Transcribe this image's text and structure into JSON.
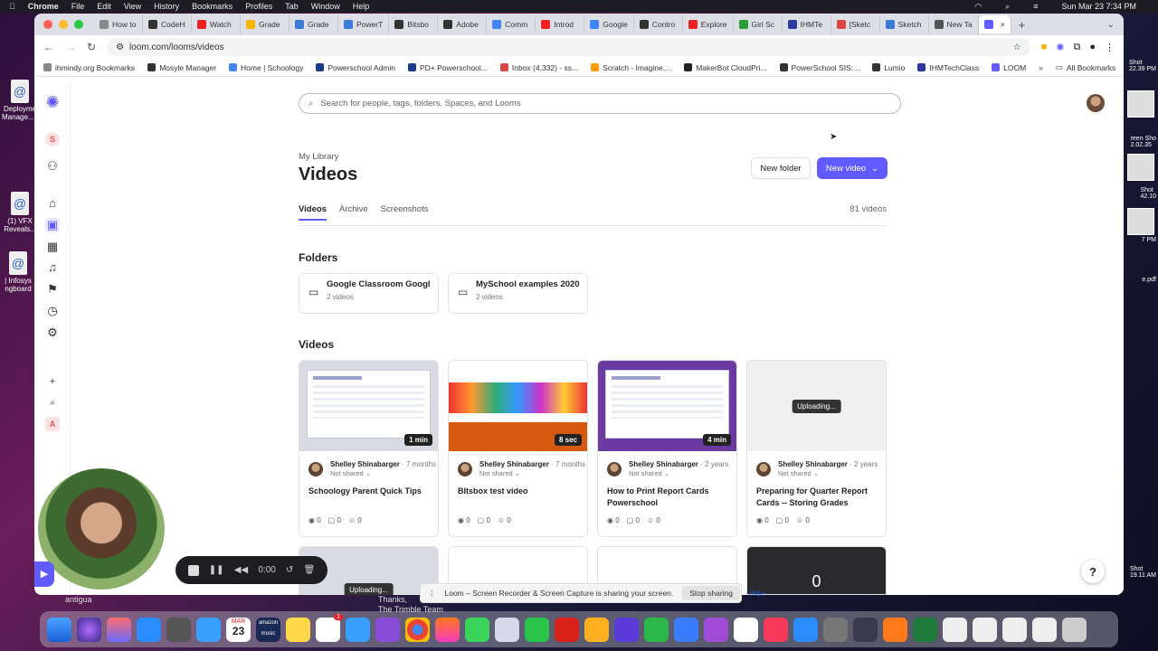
{
  "menubar": {
    "apple": "",
    "app": "Chrome",
    "items": [
      "File",
      "Edit",
      "View",
      "History",
      "Bookmarks",
      "Profiles",
      "Tab",
      "Window",
      "Help"
    ],
    "clock": "Sun Mar 23  7:34 PM"
  },
  "desktop": {
    "left_labels": [
      "Deployme\nManage...e",
      "(1) VFX\nReveals...",
      "| Infosys\nngboard"
    ],
    "right_labels": [
      "Shot\n22.39 PM",
      "reen Sho\n2.02.35",
      "Shot\n42.10",
      "7 PM",
      "e.pdf",
      "Shot\n19.11 AM"
    ],
    "bg_texts": [
      "antigua",
      "Thanks,",
      "The Trimble Team"
    ]
  },
  "tabs": [
    {
      "label": "How to",
      "color": "#888"
    },
    {
      "label": "CodeH",
      "color": "#333"
    },
    {
      "label": "Watch",
      "color": "#e22"
    },
    {
      "label": "Grade",
      "color": "#f4b400"
    },
    {
      "label": "Grade",
      "color": "#3a7bd5"
    },
    {
      "label": "PowerT",
      "color": "#3a7bd5"
    },
    {
      "label": "Bitsbo",
      "color": "#333"
    },
    {
      "label": "Adobe",
      "color": "#333"
    },
    {
      "label": "Comm",
      "color": "#4285f4"
    },
    {
      "label": "Introd",
      "color": "#e22"
    },
    {
      "label": "Google",
      "color": "#4285f4"
    },
    {
      "label": "Contro",
      "color": "#333"
    },
    {
      "label": "Explore",
      "color": "#e22"
    },
    {
      "label": "Girl Sc",
      "color": "#2a9d3a"
    },
    {
      "label": "IHMTe",
      "color": "#2a3aa0"
    },
    {
      "label": "[Sketc",
      "color": "#d44"
    },
    {
      "label": "Sketch",
      "color": "#3a7bd5"
    },
    {
      "label": "New Ta",
      "color": "#555"
    },
    {
      "label": "",
      "color": "#615bff"
    }
  ],
  "toolbar": {
    "url": "loom.com/looms/videos"
  },
  "bookmarks": [
    {
      "label": "ihmindy.org Bookmarks",
      "color": "#888"
    },
    {
      "label": "Mosyle Manager",
      "color": "#333"
    },
    {
      "label": "Home | Schoology",
      "color": "#4285f4"
    },
    {
      "label": "Powerschool Admin",
      "color": "#1a3a8a"
    },
    {
      "label": "PD+ Powerschool...",
      "color": "#1a3a8a"
    },
    {
      "label": "Inbox (4,332) - ss...",
      "color": "#d44"
    },
    {
      "label": "Scratch - Imagine,...",
      "color": "#f90"
    },
    {
      "label": "MakerBot CloudPri...",
      "color": "#222"
    },
    {
      "label": "PowerSchool SIS:...",
      "color": "#333"
    },
    {
      "label": "Lumio",
      "color": "#333"
    },
    {
      "label": "IHMTechClass",
      "color": "#2a3aa0"
    },
    {
      "label": "LOOM",
      "color": "#615bff"
    }
  ],
  "all_bookmarks": "All Bookmarks",
  "loom": {
    "search_placeholder": "Search for people, tags, folders, Spaces, and Looms",
    "workspace_initial": "S",
    "bottom_initial": "A",
    "breadcrumb": "My Library",
    "title": "Videos",
    "new_folder": "New folder",
    "new_video": "New video",
    "tabs": [
      "Videos",
      "Archive",
      "Screenshots"
    ],
    "count": "81 videos",
    "folders_heading": "Folders",
    "folders": [
      {
        "name": "Google Classroom Googl...",
        "count": "2 videos"
      },
      {
        "name": "MySchool examples 2020",
        "count": "2 videos"
      }
    ],
    "videos_heading": "Videos",
    "videos": [
      {
        "duration": "1 min",
        "author": "Shelley Shinabarger",
        "ago": "· 7 months",
        "shared": "Not shared",
        "title": "Schoology Parent Quick Tips",
        "views": "0",
        "comments": "0",
        "reactions": "0"
      },
      {
        "duration": "8 sec",
        "author": "Shelley Shinabarger",
        "ago": "· 7 months",
        "shared": "Not shared",
        "title": "BItsbox test video",
        "views": "0",
        "comments": "0",
        "reactions": "0"
      },
      {
        "duration": "4 min",
        "author": "Shelley Shinabarger",
        "ago": "· 2 years",
        "shared": "Not shared",
        "title": "How to Print Report Cards Powerschool",
        "views": "0",
        "comments": "0",
        "reactions": "0"
      },
      {
        "uploading": "Uploading...",
        "author": "Shelley Shinabarger",
        "ago": "· 2 years",
        "shared": "Not shared",
        "title": "Preparing for Quarter Report Cards -- Storing Grades",
        "views": "0",
        "comments": "0",
        "reactions": "0"
      }
    ],
    "row2_overlays": [
      "Uploading...",
      "",
      "",
      "0"
    ],
    "help": "?"
  },
  "recorder": {
    "time": "0:00"
  },
  "sharebar": {
    "text": "Loom – Screen Recorder & Screen Capture is sharing your screen.",
    "stop": "Stop sharing",
    "hide": "Hide"
  },
  "dock": {
    "calendar_month": "MAR",
    "calendar_day": "23",
    "amazon": "amazon music",
    "badge": "1"
  }
}
